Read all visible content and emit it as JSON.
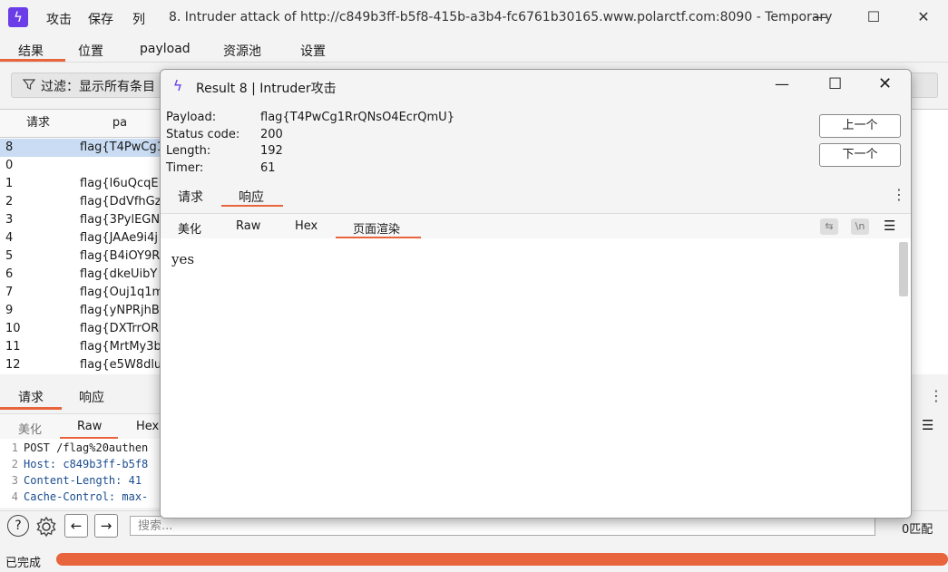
{
  "app": {
    "menu": [
      "攻击",
      "保存",
      "列"
    ],
    "window_title": "8. Intruder attack of http://c849b3ff-b5f8-415b-a3b4-fc6761b30165.www.polarctf.com:8090 - Temporary",
    "window_buttons": [
      "—",
      "☐",
      "✕"
    ]
  },
  "main_tabs": [
    "结果",
    "位置",
    "payload",
    "资源池",
    "设置"
  ],
  "filter": {
    "label": "过滤：显示所有条目"
  },
  "table": {
    "headers": [
      "请求",
      "pa"
    ],
    "rows": [
      {
        "req": "8",
        "payload": "flag{T4PwCg1"
      },
      {
        "req": "0",
        "payload": ""
      },
      {
        "req": "1",
        "payload": "flag{l6uQcqE"
      },
      {
        "req": "2",
        "payload": "flag{DdVfhGz"
      },
      {
        "req": "3",
        "payload": "flag{3PylEGN"
      },
      {
        "req": "4",
        "payload": "flag{JAAe9i4j"
      },
      {
        "req": "5",
        "payload": "flag{B4iOY9R"
      },
      {
        "req": "6",
        "payload": "flag{dkeUibY"
      },
      {
        "req": "7",
        "payload": "flag{Ouj1q1m"
      },
      {
        "req": "9",
        "payload": "flag{yNPRjhB"
      },
      {
        "req": "10",
        "payload": "flag{DXTrrOR"
      },
      {
        "req": "11",
        "payload": "flag{MrtMy3b"
      },
      {
        "req": "12",
        "payload": "flag{e5W8dlu"
      }
    ]
  },
  "lower": {
    "tabs": [
      "请求",
      "响应"
    ],
    "sub_tabs": [
      "美化",
      "Raw",
      "Hex"
    ],
    "code": [
      {
        "n": "1",
        "text": "POST /flag%20authen"
      },
      {
        "n": "2",
        "text": "Host: c849b3ff-b5f8"
      },
      {
        "n": "3",
        "text": "Content-Length: 41"
      },
      {
        "n": "4",
        "text": "Cache-Control: max-"
      }
    ]
  },
  "bottom": {
    "search_placeholder": "搜索...",
    "matches": "0匹配",
    "status": "已完成"
  },
  "dialog": {
    "title": "Result 8 | Intruder攻击",
    "info": [
      {
        "label": "Payload:",
        "value": "flag{T4PwCg1RrQNsO4EcrQmU}"
      },
      {
        "label": "Status code:",
        "value": "200"
      },
      {
        "label": "Length:",
        "value": "192"
      },
      {
        "label": "Timer:",
        "value": "61"
      }
    ],
    "prev_button": "上一个",
    "next_button": "下一个",
    "tabs": [
      "请求",
      "响应"
    ],
    "sub_tabs": [
      "美化",
      "Raw",
      "Hex",
      "页面渲染"
    ],
    "wrap_icon": "\\n",
    "render_text": "yes"
  },
  "colors": {
    "accent": "#e8643c",
    "brand": "#6a3de8",
    "selected_row": "#c9dcf3"
  }
}
